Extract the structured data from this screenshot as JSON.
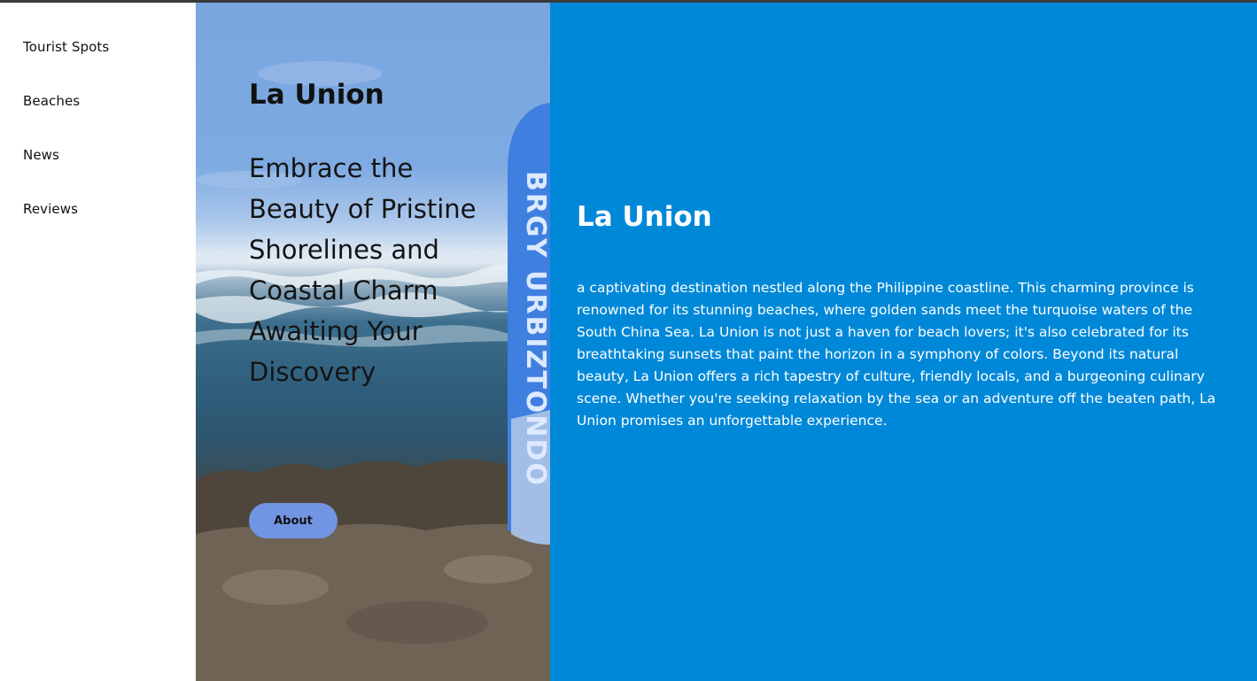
{
  "nav": {
    "items": [
      "Tourist Spots",
      "Beaches",
      "News",
      "Reviews"
    ]
  },
  "hero": {
    "title": "La Union",
    "tagline": "Embrace the Beauty of Pristine Shorelines and Coastal Charm Awaiting Your Discovery",
    "about_label": "About",
    "surfboard_text": "BRGY URBIZTONDO"
  },
  "content": {
    "title": "La Union",
    "description": "a captivating destination nestled along the Philippine coastline. This charming province is renowned for its stunning beaches, where golden sands meet the turquoise waters of the South China Sea. La Union is not just a haven for beach lovers; it's also celebrated for its breathtaking sunsets that paint the horizon in a symphony of colors. Beyond its natural beauty, La Union offers a rich tapestry of culture, friendly locals, and a burgeoning culinary scene. Whether you're seeking relaxation by the sea or an adventure off the beaten path, La Union promises an unforgettable experience."
  },
  "colors": {
    "panel_blue": "#0088d8",
    "button_blue": "#7295e3",
    "sidebar_bg": "#ffffff"
  }
}
